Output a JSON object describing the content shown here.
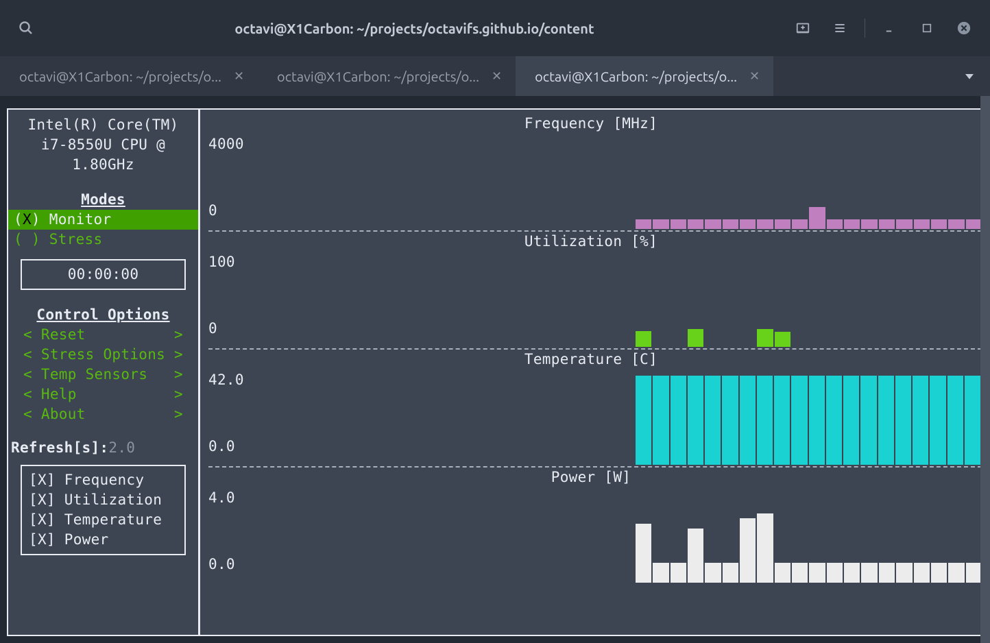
{
  "window": {
    "title": "octavi@X1Carbon: ~/projects/octavifs.github.io/content"
  },
  "tabs": [
    {
      "label": "octavi@X1Carbon: ~/projects/o...",
      "active": false
    },
    {
      "label": "octavi@X1Carbon: ~/projects/o...",
      "active": false
    },
    {
      "label": "octavi@X1Carbon: ~/projects/o...",
      "active": true
    }
  ],
  "sidebar": {
    "cpu_name": "Intel(R) Core(TM)\ni7-8550U CPU @\n1.80GHz",
    "modes_title": "Modes",
    "modes": [
      {
        "label": "Monitor",
        "selected": true
      },
      {
        "label": "Stress",
        "selected": false
      }
    ],
    "timer": "00:00:00",
    "control_title": "Control Options",
    "controls": [
      "Reset",
      "Stress Options",
      "Temp Sensors",
      "Help",
      "About"
    ],
    "refresh_label": "Refresh[s]:",
    "refresh_value": "2.0",
    "checks": [
      {
        "label": "Frequency",
        "checked": true
      },
      {
        "label": "Utilization",
        "checked": true
      },
      {
        "label": "Temperature",
        "checked": true
      },
      {
        "label": "Power",
        "checked": true
      }
    ]
  },
  "chart_data": [
    {
      "type": "bar",
      "title": "Frequency [MHz]",
      "ylabel_top": "4000",
      "ylabel_bot": "0",
      "ylim": [
        0,
        4000
      ],
      "values": [
        400,
        400,
        400,
        400,
        400,
        400,
        400,
        400,
        400,
        400,
        900,
        400,
        400,
        400,
        400,
        400,
        400,
        400,
        400,
        400
      ],
      "color": "#c07fbf"
    },
    {
      "type": "bar",
      "title": "Utilization [%]",
      "ylabel_top": "100",
      "ylabel_bot": "0",
      "ylim": [
        0,
        100
      ],
      "values": [
        16,
        0,
        0,
        18,
        0,
        0,
        0,
        18,
        15,
        0,
        0,
        0,
        0,
        0,
        0,
        0,
        0,
        0,
        0,
        0
      ],
      "color": "#67d219"
    },
    {
      "type": "bar",
      "title": "Temperature [C]",
      "ylabel_top": "42.0",
      "ylabel_bot": "0.0",
      "ylim": [
        0,
        42
      ],
      "values": [
        38,
        38,
        38,
        38,
        38,
        38,
        38,
        38,
        38,
        38,
        38,
        38,
        38,
        38,
        38,
        38,
        38,
        38,
        38,
        38
      ],
      "color": "#1ad2d2"
    },
    {
      "type": "bar",
      "title": "Power [W]",
      "ylabel_top": "4.0",
      "ylabel_bot": "0.0",
      "ylim": [
        0,
        4
      ],
      "values": [
        2.4,
        0.8,
        0.8,
        2.2,
        0.8,
        0.8,
        2.6,
        2.8,
        0.8,
        0.8,
        0.8,
        0.8,
        0.8,
        0.8,
        0.8,
        0.8,
        0.8,
        0.8,
        0.8,
        0.8
      ],
      "color": "#ececec"
    }
  ]
}
